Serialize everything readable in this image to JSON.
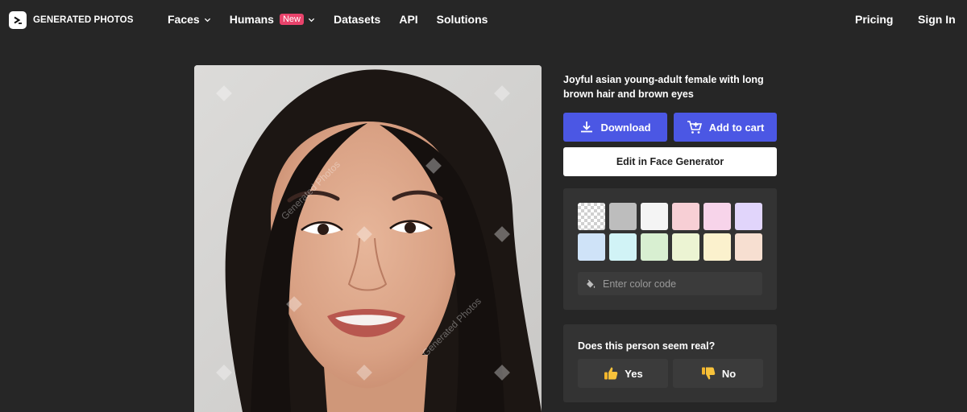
{
  "brand": {
    "name": "GENERATED PHOTOS",
    "logo_icon": "chevron-right-logo-icon"
  },
  "nav": {
    "items": [
      {
        "label": "Faces",
        "dropdown": true
      },
      {
        "label": "Humans",
        "badge": "New",
        "dropdown": true
      },
      {
        "label": "Datasets"
      },
      {
        "label": "API"
      },
      {
        "label": "Solutions"
      }
    ],
    "pricing": "Pricing",
    "sign_in": "Sign In"
  },
  "photo": {
    "watermark": "Generated Photos"
  },
  "detail": {
    "description": "Joyful asian young-adult female with long brown hair and brown eyes",
    "download_label": "Download",
    "download_icon": "download-icon",
    "cart_label": "Add to cart",
    "cart_icon": "cart-add-icon",
    "edit_label": "Edit in Face Generator"
  },
  "colors": {
    "swatches": [
      {
        "name": "transparent",
        "color": "checkerboard"
      },
      {
        "name": "gray",
        "color": "#bdbdbd"
      },
      {
        "name": "white",
        "color": "#f4f4f4"
      },
      {
        "name": "pink",
        "color": "#f7cfd5"
      },
      {
        "name": "light-pink",
        "color": "#f7d4ea"
      },
      {
        "name": "lavender",
        "color": "#e1d5fb"
      },
      {
        "name": "light-blue",
        "color": "#cfe3f8"
      },
      {
        "name": "light-cyan",
        "color": "#d1f3f6"
      },
      {
        "name": "light-green",
        "color": "#d8efd1"
      },
      {
        "name": "light-lime",
        "color": "#ecf4d3"
      },
      {
        "name": "light-yellow",
        "color": "#fbf1cd"
      },
      {
        "name": "peach",
        "color": "#f7dfd1"
      }
    ],
    "input_placeholder": "Enter color code",
    "input_icon": "paint-bucket-icon"
  },
  "feedback": {
    "question": "Does this person seem real?",
    "yes_label": "Yes",
    "no_label": "No",
    "yes_icon": "thumbs-up-icon",
    "no_icon": "thumbs-down-icon"
  },
  "theme": {
    "accent": "#4b57e4",
    "badge": "#e8436b",
    "background": "#262626",
    "panel": "#333333"
  }
}
